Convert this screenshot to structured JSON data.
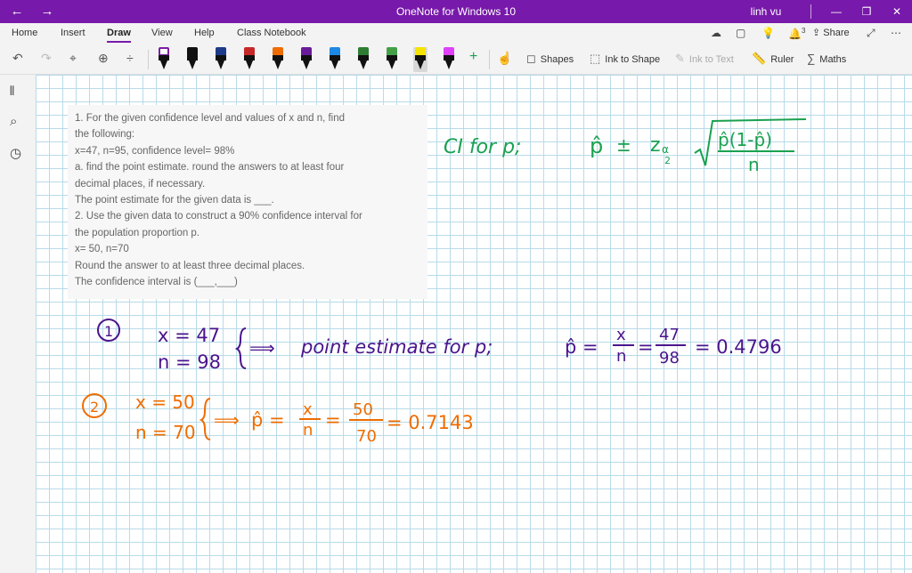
{
  "window": {
    "title": "OneNote for Windows 10",
    "user": "linh vu",
    "back_glyph": "←",
    "forward_glyph": "→",
    "minimize_glyph": "—",
    "restore_glyph": "❐",
    "close_glyph": "✕"
  },
  "tabs": [
    {
      "label": "Home"
    },
    {
      "label": "Insert"
    },
    {
      "label": "Draw"
    },
    {
      "label": "View"
    },
    {
      "label": "Help"
    },
    {
      "label": "Class Notebook"
    }
  ],
  "active_tab": "Draw",
  "header_right": {
    "notif_count": "3",
    "share_label": "Share"
  },
  "toolbar": {
    "shapes_label": "Shapes",
    "ink_to_shape_label": "Ink to Shape",
    "ink_to_text_label": "Ink to Text",
    "ruler_label": "Ruler",
    "maths_label": "Maths",
    "pens": [
      {
        "color": "#7b1fa2",
        "cap": "#ffffff"
      },
      {
        "color": "#111111",
        "cap": "#111111"
      },
      {
        "color": "#1e3a8a",
        "cap": "#1e3a8a"
      },
      {
        "color": "#111111",
        "cap": "#c62828"
      },
      {
        "color": "#111111",
        "cap": "#ef6c00"
      },
      {
        "color": "#111111",
        "cap": "#6a1b9a"
      },
      {
        "color": "#111111",
        "cap": "#1e88e5"
      },
      {
        "color": "#111111",
        "cap": "#2e7d32"
      },
      {
        "color": "#111111",
        "cap": "#43a047"
      },
      {
        "color": "#111111",
        "cap": "#f5e400"
      },
      {
        "color": "#111111",
        "cap": "#e040fb"
      }
    ]
  },
  "problem": {
    "lines": [
      "1. For the given confidence level and values of x and n, find",
      "the following:",
      "x=47, n=95, confidence level= 98%",
      "a. find the point estimate. round the answers to at least four",
      "decimal places, if necessary.",
      "The point estimate for the given data is ___.",
      "2. Use the given data to construct a 90% confidence interval for",
      "the population proportion p.",
      "x= 50, n=70",
      "Round the answer to at least three decimal places.",
      "The confidence interval is (___,___)"
    ]
  },
  "ink": {
    "green_label": "CI for p;",
    "green_phat": "p̂",
    "green_pm": "±",
    "green_z": "z",
    "green_alpha": "α",
    "green_two": "2",
    "green_num": "p̂(1-p̂)",
    "green_den": "n",
    "circle1": "1",
    "x1": "x = 47",
    "n1": "n = 98",
    "implies1": "⟹",
    "text1": "point estimate for p;",
    "phat1": "p̂ =",
    "frac1_num": "x",
    "frac1_den": "n",
    "eq1": "=",
    "frac1b_num": "47",
    "frac1b_den": "98",
    "result1": "= 0.4796",
    "circle2": "2",
    "x2": "x = 50",
    "n2": "n = 70",
    "implies2": "⟹",
    "phat2": "p̂ =",
    "frac2_num": "x",
    "frac2_den": "n",
    "eq2": "=",
    "frac2b_num": "50",
    "frac2b_den": "70",
    "result2": "= 0.7143",
    "green_color": "#1aa150",
    "purple_color": "#4a148c",
    "orange_color": "#ef6c00"
  }
}
